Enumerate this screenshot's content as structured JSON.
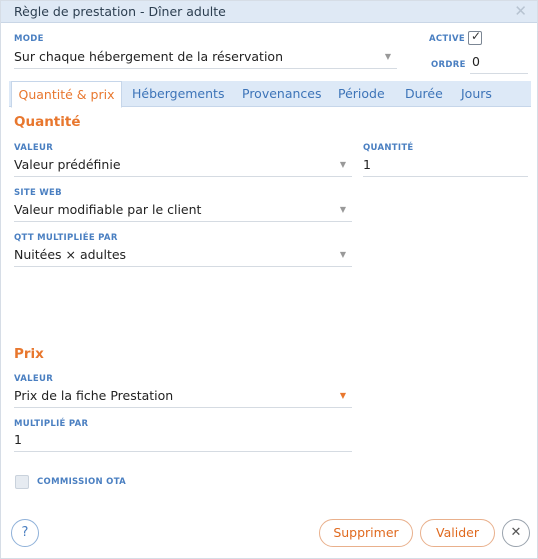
{
  "dialog": {
    "title": "Règle de prestation - Dîner adulte",
    "close_icon": "close-icon"
  },
  "header": {
    "mode_label": "MODE",
    "mode_value": "Sur chaque hébergement de la réservation",
    "active_label": "ACTIVE",
    "active_checked": true,
    "order_label": "ORDRE",
    "order_value": "0"
  },
  "tabs": [
    {
      "label": "Quantité & prix",
      "active": true
    },
    {
      "label": "Hébergements",
      "active": false
    },
    {
      "label": "Provenances",
      "active": false
    },
    {
      "label": "Période",
      "active": false
    },
    {
      "label": "Durée",
      "active": false
    },
    {
      "label": "Jours",
      "active": false
    }
  ],
  "quantity_section": {
    "title": "Quantité",
    "value_label": "VALEUR",
    "value": "Valeur prédéfinie",
    "quantity_label": "QUANTITÉ",
    "quantity": "1",
    "website_label": "SITE WEB",
    "website_value": "Valeur modifiable par le client",
    "multiplied_label": "QTT MULTIPLIÉE PAR",
    "multiplied_value": "Nuitées × adultes"
  },
  "price_section": {
    "title": "Prix",
    "value_label": "VALEUR",
    "value": "Prix de la fiche Prestation",
    "multiplier_label": "MULTIPLIÉ PAR",
    "multiplier_value": "1",
    "commission_label": "COMMISSION OTA",
    "commission_checked": false
  },
  "footer": {
    "help_label": "?",
    "delete_label": "Supprimer",
    "validate_label": "Valider",
    "close_label": "✕"
  },
  "colors": {
    "accent": "#e8772e",
    "label_blue": "#4a7fc1",
    "title_bar": "#dfe9f5"
  }
}
